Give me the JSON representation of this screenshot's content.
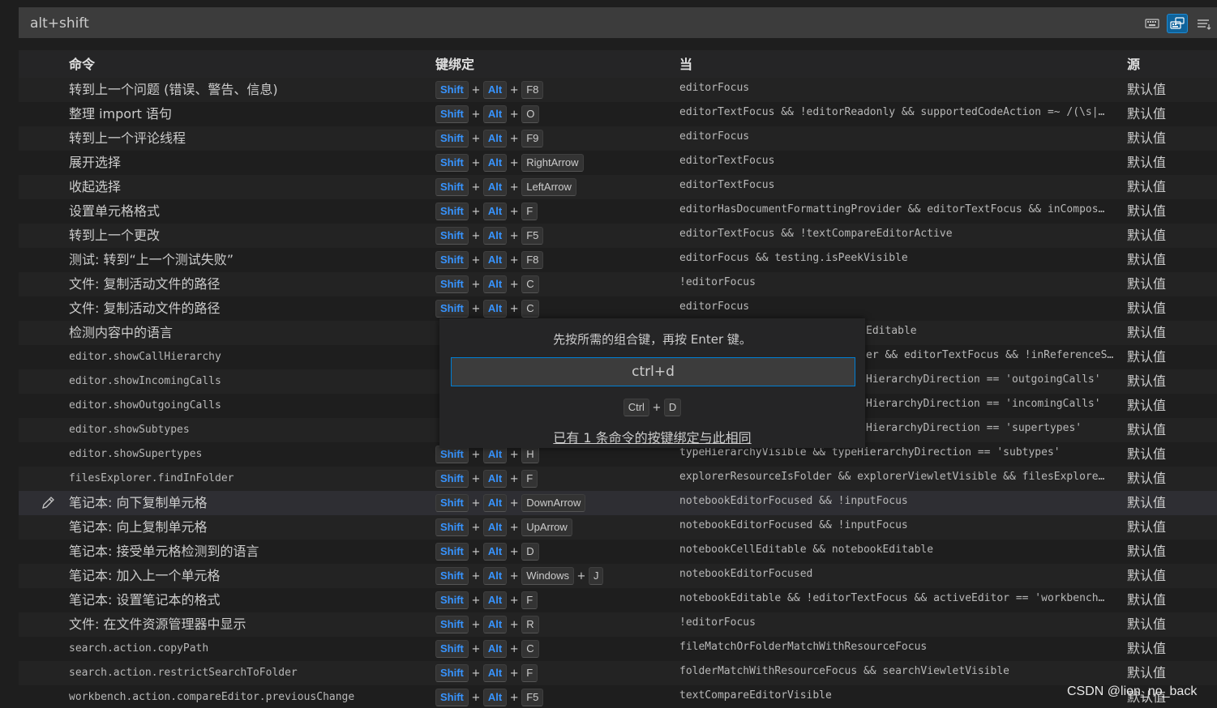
{
  "search": {
    "value": "alt+shift"
  },
  "toolbar_icons": [
    "keyboard-icon",
    "record-keys-icon",
    "sort-by-precedence-icon"
  ],
  "columns": {
    "command": "命令",
    "keybinding": "键绑定",
    "when": "当",
    "source": "源"
  },
  "rows": [
    {
      "command": "转到上一个问题 (错误、警告、信息)",
      "keys": [
        "Shift",
        "Alt",
        "F8"
      ],
      "when": "editorFocus",
      "source": "默认值"
    },
    {
      "command": "整理 import 语句",
      "keys": [
        "Shift",
        "Alt",
        "O"
      ],
      "when": "editorTextFocus && !editorReadonly && supportedCodeAction =~ /(\\s|…",
      "source": "默认值"
    },
    {
      "command": "转到上一个评论线程",
      "keys": [
        "Shift",
        "Alt",
        "F9"
      ],
      "when": "editorFocus",
      "source": "默认值"
    },
    {
      "command": "展开选择",
      "keys": [
        "Shift",
        "Alt",
        "RightArrow"
      ],
      "when": "editorTextFocus",
      "source": "默认值"
    },
    {
      "command": "收起选择",
      "keys": [
        "Shift",
        "Alt",
        "LeftArrow"
      ],
      "when": "editorTextFocus",
      "source": "默认值"
    },
    {
      "command": "设置单元格格式",
      "keys": [
        "Shift",
        "Alt",
        "F"
      ],
      "when": "editorHasDocumentFormattingProvider && editorTextFocus && inCompos…",
      "source": "默认值"
    },
    {
      "command": "转到上一个更改",
      "keys": [
        "Shift",
        "Alt",
        "F5"
      ],
      "when": "editorTextFocus && !textCompareEditorActive",
      "source": "默认值"
    },
    {
      "command": "测试: 转到“上一个测试失败”",
      "keys": [
        "Shift",
        "Alt",
        "F8"
      ],
      "when": "editorFocus && testing.isPeekVisible",
      "source": "默认值"
    },
    {
      "command": "文件: 复制活动文件的路径",
      "keys": [
        "Shift",
        "Alt",
        "C"
      ],
      "when": "!editorFocus",
      "source": "默认值"
    },
    {
      "command": "文件: 复制活动文件的路径",
      "keys": [
        "Shift",
        "Alt",
        "C"
      ],
      "when": "editorFocus",
      "source": "默认值"
    },
    {
      "command": "检测内容中的语言",
      "keys": [],
      "when": "Editable",
      "source": "默认值"
    },
    {
      "command": "editor.showCallHierarchy",
      "mono": true,
      "keys": [],
      "when": "er && editorTextFocus && !inReferenceS…",
      "source": "默认值"
    },
    {
      "command": "editor.showIncomingCalls",
      "mono": true,
      "keys": [],
      "when": "HierarchyDirection == 'outgoingCalls'",
      "source": "默认值"
    },
    {
      "command": "editor.showOutgoingCalls",
      "mono": true,
      "keys": [],
      "when": "HierarchyDirection == 'incomingCalls'",
      "source": "默认值"
    },
    {
      "command": "editor.showSubtypes",
      "mono": true,
      "keys": [],
      "when": "HierarchyDirection == 'supertypes'",
      "source": "默认值"
    },
    {
      "command": "editor.showSupertypes",
      "mono": true,
      "keys": [
        "Shift",
        "Alt",
        "H"
      ],
      "when": "typeHierarchyVisible && typeHierarchyDirection == 'subtypes'",
      "source": "默认值"
    },
    {
      "command": "filesExplorer.findInFolder",
      "mono": true,
      "keys": [
        "Shift",
        "Alt",
        "F"
      ],
      "when": "explorerResourceIsFolder && explorerViewletVisible && filesExplore…",
      "source": "默认值"
    },
    {
      "command": "笔记本: 向下复制单元格",
      "keys": [
        "Shift",
        "Alt",
        "DownArrow"
      ],
      "when": "notebookEditorFocused && !inputFocus",
      "source": "默认值",
      "selected": true
    },
    {
      "command": "笔记本: 向上复制单元格",
      "keys": [
        "Shift",
        "Alt",
        "UpArrow"
      ],
      "when": "notebookEditorFocused && !inputFocus",
      "source": "默认值"
    },
    {
      "command": "笔记本: 接受单元格检测到的语言",
      "keys": [
        "Shift",
        "Alt",
        "D"
      ],
      "when": "notebookCellEditable && notebookEditable",
      "source": "默认值"
    },
    {
      "command": "笔记本: 加入上一个单元格",
      "keys": [
        "Shift",
        "Alt",
        "Windows",
        "J"
      ],
      "when": "notebookEditorFocused",
      "source": "默认值"
    },
    {
      "command": "笔记本: 设置笔记本的格式",
      "keys": [
        "Shift",
        "Alt",
        "F"
      ],
      "when": "notebookEditable && !editorTextFocus && activeEditor == 'workbench…",
      "source": "默认值"
    },
    {
      "command": "文件: 在文件资源管理器中显示",
      "keys": [
        "Shift",
        "Alt",
        "R"
      ],
      "when": "!editorFocus",
      "source": "默认值"
    },
    {
      "command": "search.action.copyPath",
      "mono": true,
      "keys": [
        "Shift",
        "Alt",
        "C"
      ],
      "when": "fileMatchOrFolderMatchWithResourceFocus",
      "source": "默认值"
    },
    {
      "command": "search.action.restrictSearchToFolder",
      "mono": true,
      "keys": [
        "Shift",
        "Alt",
        "F"
      ],
      "when": "folderMatchWithResourceFocus && searchViewletVisible",
      "source": "默认值"
    },
    {
      "command": "workbench.action.compareEditor.previousChange",
      "mono": true,
      "keys": [
        "Shift",
        "Alt",
        "F5"
      ],
      "when": "textCompareEditorVisible",
      "source": "默认值"
    }
  ],
  "highlight_keys": [
    "Shift",
    "Alt"
  ],
  "dialog": {
    "message": "先按所需的组合键，再按 Enter 键。",
    "input_value": "ctrl+d",
    "keys": [
      "Ctrl",
      "D"
    ],
    "conflict": "已有 1 条命令的按键绑定与此相同"
  },
  "watermark": "CSDN @lion_no_back"
}
